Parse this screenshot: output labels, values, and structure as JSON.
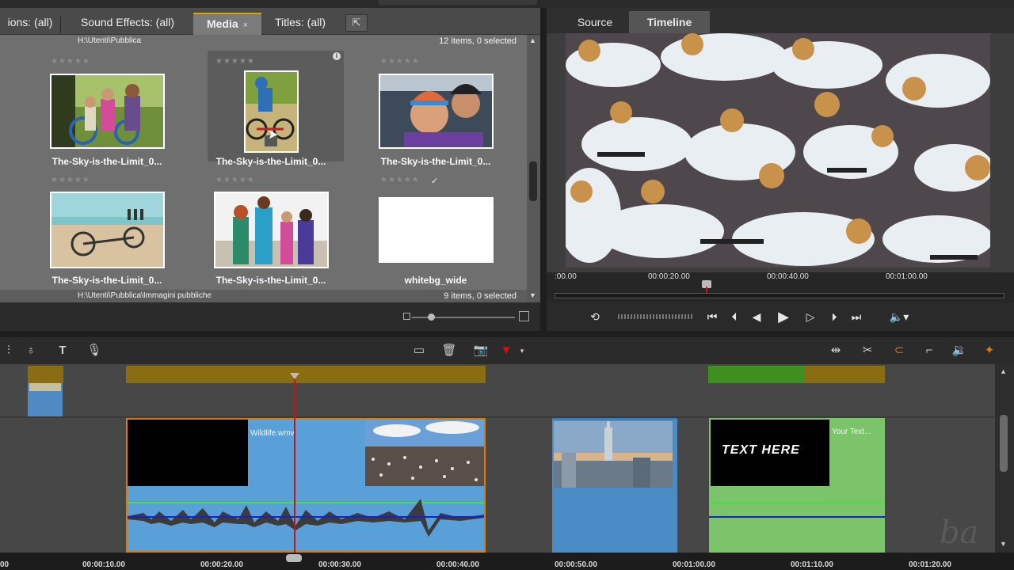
{
  "library": {
    "tabs": [
      {
        "label": "ions: (all)"
      },
      {
        "label": "Sound Effects: (all)"
      },
      {
        "label": "Media",
        "close": "×"
      },
      {
        "label": "Titles: (all)"
      }
    ],
    "top_section": {
      "path": "H:\\Utenti\\Pubblica",
      "count": "12 items, 0 selected"
    },
    "bottom_section": {
      "path": "H:\\Utenti\\Pubblica\\Immagini pubbliche",
      "count": "9 items, 0 selected"
    },
    "stars": "★★★★★",
    "check": "✓",
    "items": [
      {
        "label": "The-Sky-is-the-Limit_0..."
      },
      {
        "label": "The-Sky-is-the-Limit_0..."
      },
      {
        "label": "The-Sky-is-the-Limit_0..."
      },
      {
        "label": "The-Sky-is-the-Limit_0..."
      },
      {
        "label": "The-Sky-is-the-Limit_0..."
      },
      {
        "label": "whitebg_wide"
      }
    ]
  },
  "player": {
    "tabs": [
      {
        "label": "Source"
      },
      {
        "label": "Timeline"
      }
    ],
    "ruler": [
      ":00.00",
      "00:00:20.00",
      "00:00:40.00",
      "00:01:00.00"
    ]
  },
  "timeline": {
    "clips": [
      {
        "title": "Wildlife.wmv"
      },
      {
        "title": "Your Text..."
      }
    ],
    "title_clip_text": "TEXT HERE",
    "ruler": [
      "00",
      "00:00:10.00",
      "00:00:20.00",
      "00:00:30.00",
      "00:00:40.00",
      "00:00:50.00",
      "00:01:00.00",
      "00:01:10.00",
      "00:01:20.00"
    ]
  },
  "colors": {
    "accent_gold": "#d8a400",
    "marker_gold": "#8a6d12",
    "marker_green": "#3f8f1f",
    "video_clip_blue": "#5aa0d8",
    "title_clip_green": "#7cc46a",
    "playhead_red": "#d01010"
  }
}
